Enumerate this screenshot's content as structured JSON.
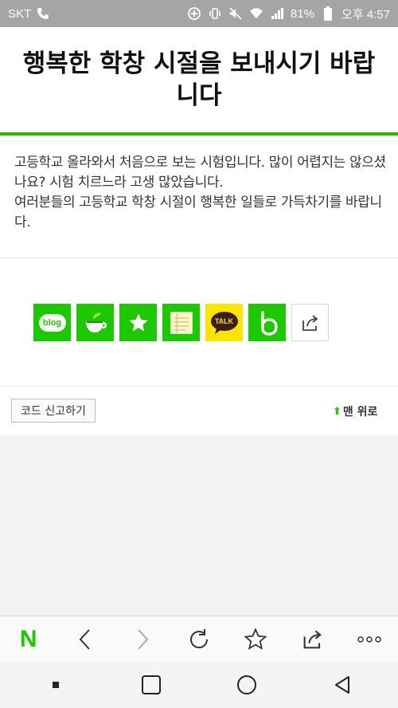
{
  "status_bar": {
    "carrier": "SKT",
    "battery": "81%",
    "time": "오후 4:57",
    "icons": [
      "phone-icon",
      "location-icon",
      "vibrate-icon",
      "mute-icon",
      "wifi-icon",
      "signal-icon",
      "battery-icon"
    ]
  },
  "article": {
    "title": "행복한 학창 시절을 보내시기 바랍니다",
    "body": [
      "고등학교 올라와서 처음으로 보는 시험입니다. 많이 어렵지는 않으셨나요? 시험 치르느라 고생 많았습니다.",
      "여러분들의 고등학교 학창 시절이 행복한 일들로 가득차기를 바랍니다."
    ]
  },
  "share": {
    "buttons": [
      {
        "name": "blog-share-button",
        "label": "blog"
      },
      {
        "name": "cafe-share-button",
        "label": ""
      },
      {
        "name": "bookmark-share-button",
        "label": ""
      },
      {
        "name": "memo-share-button",
        "label": ""
      },
      {
        "name": "kakaotalk-share-button",
        "label": "TALK"
      },
      {
        "name": "band-share-button",
        "label": ""
      },
      {
        "name": "more-share-button",
        "label": ""
      }
    ]
  },
  "footer": {
    "report_label": "코드 신고하기",
    "top_label": "맨 위로"
  },
  "colors": {
    "naver_green": "#1ec800",
    "accent_line": "#2db400",
    "kakao_yellow": "#fee500",
    "status_bar": "#a5a5a5"
  },
  "toolbar": {
    "items": [
      "naver-home-icon",
      "back-icon",
      "forward-icon",
      "refresh-icon",
      "star-icon",
      "share-icon",
      "more-icon"
    ]
  },
  "navbar": {
    "items": [
      "recent-apps-dot-icon",
      "overview-square-icon",
      "home-circle-icon",
      "back-triangle-icon"
    ]
  }
}
